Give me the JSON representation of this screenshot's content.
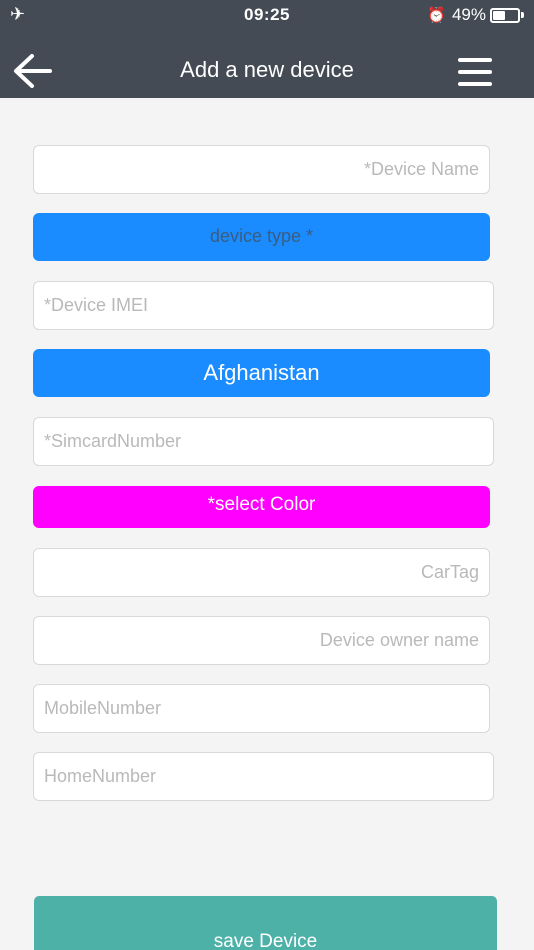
{
  "status_bar": {
    "time": "09:25",
    "battery": "49%",
    "battery_level": 0.49
  },
  "header": {
    "title": "Add a new device"
  },
  "form": {
    "device_name_placeholder": "*Device Name",
    "device_type_label": "device type *",
    "device_imei_placeholder": "*Device IMEI",
    "country_label": "Afghanistan",
    "simcard_placeholder": "*SimcardNumber",
    "select_color_label": "*select Color",
    "cartag_placeholder": "CarTag",
    "owner_name_placeholder": "Device owner name",
    "mobile_placeholder": "MobileNumber",
    "home_placeholder": "HomeNumber"
  },
  "footer": {
    "save_label": "save Device"
  },
  "colors": {
    "header_bg": "#444b54",
    "blue_button": "#1a8cff",
    "color_button": "#ff00ff",
    "save_button": "#4db1a8"
  }
}
